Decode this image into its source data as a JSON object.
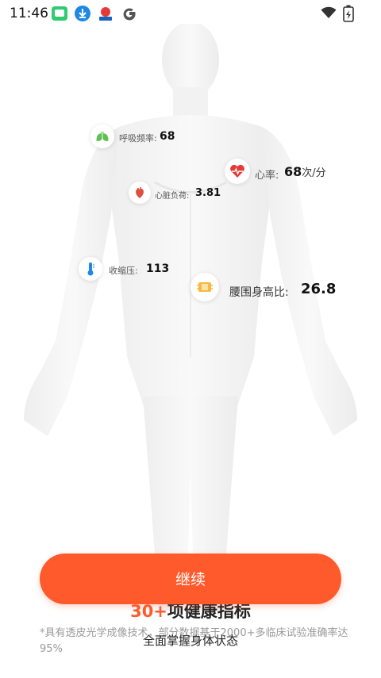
{
  "status_bar": {
    "time": "11:46"
  },
  "metrics": {
    "breathing": {
      "label": "呼吸频率:",
      "value": "68"
    },
    "heart_rate": {
      "label": "心率:",
      "value": "68",
      "unit": "次/分"
    },
    "cardiac_load": {
      "label": "心脏负荷:",
      "value": "3.81"
    },
    "systolic": {
      "label": "收缩压:",
      "value": "113"
    },
    "waist_height": {
      "label": "腰围身高比:",
      "value": "26.8"
    }
  },
  "cta": {
    "label": "继续"
  },
  "overlay": {
    "title_accent": "30+",
    "title_rest": "项健康指标",
    "disclaimer": "*具有透皮光学成像技术，部分数据基于2000+多临床试验准确率达95%",
    "subtitle": "全面掌握身体状态"
  },
  "colors": {
    "accent": "#ff5a2c"
  }
}
